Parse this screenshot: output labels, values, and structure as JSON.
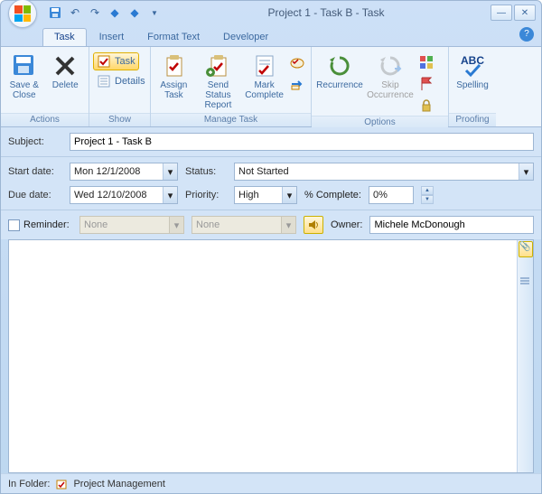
{
  "title": "Project 1 - Task B  -  Task",
  "qat": {
    "save": "save-icon",
    "undo": "undo-icon",
    "redo": "redo-icon",
    "prev": "prev-icon",
    "next": "next-icon"
  },
  "tabs": [
    "Task",
    "Insert",
    "Format Text",
    "Developer"
  ],
  "active_tab": 0,
  "ribbon": {
    "actions": {
      "label": "Actions",
      "save_close": "Save &\nClose",
      "delete": "Delete"
    },
    "show": {
      "label": "Show",
      "task": "Task",
      "details": "Details"
    },
    "manage": {
      "label": "Manage Task",
      "assign": "Assign\nTask",
      "send": "Send Status\nReport",
      "mark": "Mark\nComplete"
    },
    "options": {
      "label": "Options",
      "recurrence": "Recurrence",
      "skip": "Skip\nOccurrence"
    },
    "proofing": {
      "label": "Proofing",
      "spelling": "Spelling"
    }
  },
  "form": {
    "subject_label": "Subject:",
    "subject": "Project 1 - Task B",
    "start_label": "Start date:",
    "start": "Mon 12/1/2008",
    "due_label": "Due date:",
    "due": "Wed 12/10/2008",
    "status_label": "Status:",
    "status": "Not Started",
    "priority_label": "Priority:",
    "priority": "High",
    "pct_label": "% Complete:",
    "pct": "0%",
    "reminder_label": "Reminder:",
    "reminder_date": "None",
    "reminder_time": "None",
    "owner_label": "Owner:",
    "owner": "Michele McDonough"
  },
  "status": {
    "folder_label": "In Folder:",
    "folder": "Project Management"
  }
}
